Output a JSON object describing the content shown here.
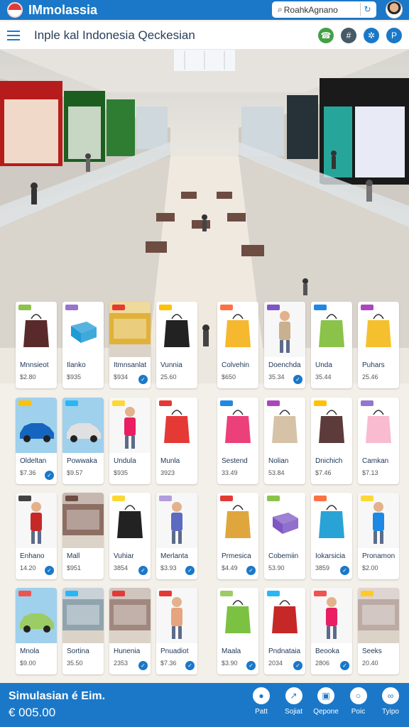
{
  "topbar": {
    "brand": "IMmolassia",
    "search_value": "RoahkAgnano",
    "colors": {
      "primary": "#1b78c8"
    }
  },
  "header": {
    "title": "Inple kal Indonesia Qeckesian",
    "icons": [
      "phone-icon",
      "hash-icon",
      "share-icon",
      "parking-icon"
    ]
  },
  "products": [
    {
      "name": "Mnnsieot",
      "price": "$2.80",
      "thumb": "bag",
      "color": "#5a2a2a",
      "tag": "#8bc34a",
      "cart": false
    },
    {
      "name": "Ilanko",
      "price": "$935",
      "thumb": "box",
      "color": "#1e9ad6",
      "tag": "#9575cd",
      "cart": false
    },
    {
      "name": "Itmnsanlat",
      "price": "$934",
      "thumb": "store",
      "color": "#e0b23a",
      "tag": "#e53935",
      "cart": true
    },
    {
      "name": "Vunnia",
      "price": "25.60",
      "thumb": "bag",
      "color": "#222222",
      "tag": "#ffc107",
      "cart": false
    },
    {
      "name": "Colvehin",
      "price": "$650",
      "thumb": "bag",
      "color": "#f5b82e",
      "tag": "#ff7043",
      "cart": false
    },
    {
      "name": "Doenchda",
      "price": "35.34",
      "thumb": "person",
      "color": "#c9b08f",
      "tag": "#7e57c2",
      "cart": true
    },
    {
      "name": "Unda",
      "price": "35.44",
      "thumb": "bag",
      "color": "#8bc34a",
      "tag": "#1e88e5",
      "cart": false
    },
    {
      "name": "Puhars",
      "price": "25.46",
      "thumb": "bag",
      "color": "#f5c02e",
      "tag": "#ab47bc",
      "cart": false
    },
    {
      "name": "Oldeltan",
      "price": "$7.36",
      "thumb": "car",
      "color": "#1565c0",
      "tag": "#ffc107",
      "cart": true
    },
    {
      "name": "Powwaka",
      "price": "$9.57",
      "thumb": "car",
      "color": "#e0e0e0",
      "tag": "#29b6f6",
      "cart": false
    },
    {
      "name": "Undula",
      "price": "$935",
      "thumb": "person",
      "color": "#e91e63",
      "tag": "#fdd835",
      "cart": false
    },
    {
      "name": "Munla",
      "price": "3923",
      "thumb": "bag",
      "color": "#e53935",
      "tag": "#e53935",
      "cart": false
    },
    {
      "name": "Sestend",
      "price": "33.49",
      "thumb": "bag",
      "color": "#ec407a",
      "tag": "#1e88e5",
      "cart": false
    },
    {
      "name": "Nolian",
      "price": "53.84",
      "thumb": "bag",
      "color": "#d6c2a6",
      "tag": "#ab47bc",
      "cart": false
    },
    {
      "name": "Dnichich",
      "price": "$7.46",
      "thumb": "bag",
      "color": "#5d3b3b",
      "tag": "#ffc107",
      "cart": false
    },
    {
      "name": "Camkan",
      "price": "$7.13",
      "thumb": "bag",
      "color": "#f8bbd0",
      "tag": "#9575cd",
      "cart": false
    },
    {
      "name": "Enhano",
      "price": "14.20",
      "thumb": "person",
      "color": "#c62828",
      "tag": "#424242",
      "cart": true
    },
    {
      "name": "Mall",
      "price": "$951",
      "thumb": "store",
      "color": "#8d6e63",
      "tag": "#6d4c41",
      "cart": false
    },
    {
      "name": "Vuhiar",
      "price": "3854",
      "thumb": "bag",
      "color": "#222222",
      "tag": "#fdd835",
      "cart": true
    },
    {
      "name": "Merlanta",
      "price": "$3.93",
      "thumb": "person",
      "color": "#5c6bc0",
      "tag": "#b39ddb",
      "cart": true
    },
    {
      "name": "Prmesica",
      "price": "$4.49",
      "thumb": "bag",
      "color": "#e0a63e",
      "tag": "#e53935",
      "cart": true
    },
    {
      "name": "Cobemiin",
      "price": "53.90",
      "thumb": "box",
      "color": "#7e57c2",
      "tag": "#8bc34a",
      "cart": false
    },
    {
      "name": "Iokarsicia",
      "price": "3859",
      "thumb": "bag",
      "color": "#29a3d6",
      "tag": "#ff7043",
      "cart": true
    },
    {
      "name": "Pronamon",
      "price": "$2.00",
      "thumb": "person",
      "color": "#1e88e5",
      "tag": "#fdd835",
      "cart": false
    },
    {
      "name": "Mnola",
      "price": "$9.00",
      "thumb": "car",
      "color": "#9ccc65",
      "tag": "#ef5350",
      "cart": false
    },
    {
      "name": "Sortina",
      "price": "35.50",
      "thumb": "store",
      "color": "#90a4ae",
      "tag": "#29b6f6",
      "cart": false
    },
    {
      "name": "Hunenia",
      "price": "2353",
      "thumb": "store",
      "color": "#a1887f",
      "tag": "#e53935",
      "cart": true
    },
    {
      "name": "Pnuadiot",
      "price": "$7.36",
      "thumb": "person",
      "color": "#e6a57e",
      "tag": "#e53935",
      "cart": true
    },
    {
      "name": "Maala",
      "price": "$3.90",
      "thumb": "bag",
      "color": "#7cc242",
      "tag": "#9ccc65",
      "cart": true
    },
    {
      "name": "Pndnataia",
      "price": "2034",
      "thumb": "bag",
      "color": "#c62828",
      "tag": "#29b6f6",
      "cart": true
    },
    {
      "name": "Beooka",
      "price": "2806",
      "thumb": "person",
      "color": "#e91e63",
      "tag": "#ef5350",
      "cart": true
    },
    {
      "name": "Seeks",
      "price": "20.40",
      "thumb": "store",
      "color": "#bcaaa4",
      "tag": "#ffca28",
      "cart": false
    }
  ],
  "bottombar": {
    "title": "Simulasian é Eim.",
    "value": "€ 005.00",
    "actions": [
      {
        "label": "Patt",
        "icon": "pin-icon"
      },
      {
        "label": "Sojiat",
        "icon": "compass-icon"
      },
      {
        "label": "Qepone",
        "icon": "calendar-icon"
      },
      {
        "label": "Poic",
        "icon": "chat-icon"
      },
      {
        "label": "Tyipo",
        "icon": "link-icon"
      }
    ]
  }
}
